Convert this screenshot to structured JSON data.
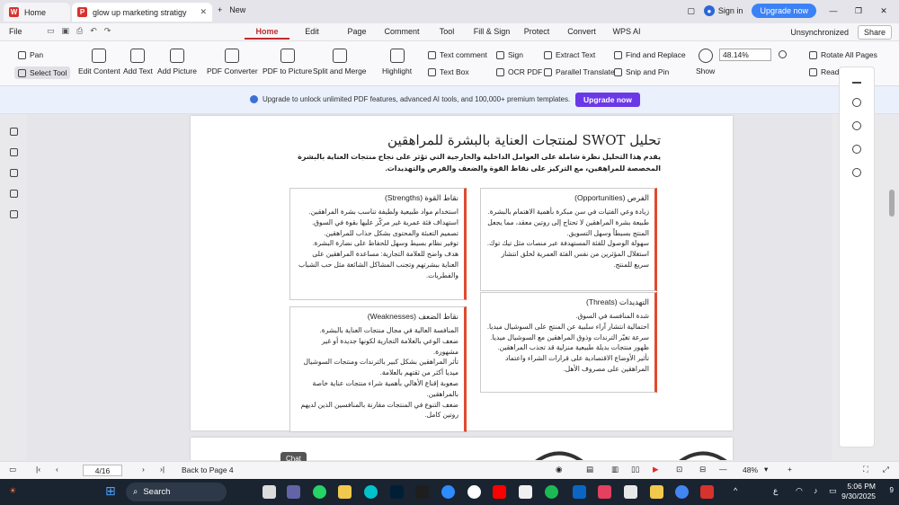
{
  "tabs": {
    "home": "Home",
    "doc": "glow up marketing stratigy",
    "new": "New"
  },
  "account": {
    "signin": "Sign in",
    "upgrade": "Upgrade now"
  },
  "menu": {
    "file": "File",
    "items": [
      "Home",
      "Edit",
      "Page",
      "Comment",
      "Tool",
      "Fill & Sign",
      "Protect",
      "Convert",
      "WPS AI"
    ],
    "sync": "Unsynchronized",
    "share": "Share"
  },
  "ribbon": {
    "pan": "Pan",
    "select": "Select Tool",
    "edit_content": "Edit Content",
    "add_text": "Add Text",
    "add_picture": "Add Picture",
    "pdf_converter": "PDF Converter",
    "pdf_to_picture": "PDF to Picture",
    "split_merge": "Split and Merge",
    "highlight": "Highlight",
    "text_comment": "Text comment",
    "text_box": "Text Box",
    "sign": "Sign",
    "ocr": "OCR PDF",
    "extract": "Extract Text",
    "parallel": "Parallel Translate",
    "find_replace": "Find and Replace",
    "snip_pin": "Snip and Pin",
    "show": "Show",
    "zoom": "48.14%",
    "rotate": "Rotate All Pages",
    "read": "Read M"
  },
  "banner": {
    "text": "Upgrade to unlock unlimited PDF features, advanced AI tools, and 100,000+ premium templates.",
    "button": "Upgrade now"
  },
  "document": {
    "title": "تحليل SWOT لمنتجات العناية بالبشرة للمراهقين",
    "intro": "يقدم هذا التحليل نظرة شاملة على العوامل الداخلية والخارجية التي تؤثر على نجاح منتجات العناية بالبشرة المخصصة للمراهقين، مع التركيز على نقاط القوة والضعف والفرص والتهديدات.",
    "opportunities_title": "الفرص (Opportunities)",
    "opportunities": [
      "زيادة وعي الفتيات في سن مبكرة بأهمية الاهتمام بالبشرة.",
      "طبيعة بشرة المراهقين لا تحتاج إلى روتين معقد، مما يجعل المنتج بسيطاً وسهل التسويق.",
      "سهولة الوصول للفئة المستهدفة عبر منصات مثل تيك توك.",
      "استغلال المؤثرين من نفس الفئة العمرية لخلق انتشار سريع للمنتج."
    ],
    "strengths_title": "نقاط القوة (Strengths)",
    "strengths": [
      "استخدام مواد طبيعية ولطيفة تناسب بشرة المراهقين.",
      "استهداف فئة عمرية غير مركّز عليها بقوة في السوق.",
      "تصميم التعبئة والمحتوى بشكل جذاب للمراهقين.",
      "توفير نظام بسيط وسهل للحفاظ على نضارة البشرة.",
      "هدف واضح للعلامة التجارية: مساعدة المراهقين على العناية ببشرتهم وتجنب المشاكل الشائعة مثل حب الشباب والفطريات."
    ],
    "threats_title": "التهديدات (Threats)",
    "threats": [
      "شدة المنافسة في السوق.",
      "احتمالية انتشار آراء سلبية عن المنتج على السوشيال ميديا.",
      "سرعة تغيّر الترندات وذوق المراهقين مع السوشيال ميديا.",
      "ظهور منتجات بديلة طبيعية منزلية قد تجذب المراهقين.",
      "تأثير الأوضاع الاقتصادية على قرارات الشراء واعتماد المراهقين على مصروف الأهل."
    ],
    "weaknesses_title": "نقاط الضعف (Weaknesses)",
    "weaknesses": [
      "المنافسة العالية في مجال منتجات العناية بالبشرة.",
      "ضعف الوعي بالعلامة التجارية لكونها جديدة أو غير مشهورة.",
      "تأثر المراهقين بشكل كبير بالترندات ومنتجات السوشيال ميديا أكثر من ثقتهم بالعلامة.",
      "صعوبة إقناع الأهالي بأهمية شراء منتجات عناية خاصة بالمراهقين.",
      "ضعف التنوع في المنتجات مقارنة بالمنافسين الذين لديهم روتين كامل."
    ]
  },
  "status": {
    "page": "4/16",
    "back": "Back to Page 4",
    "zoom": "48%",
    "chat": "Chat"
  },
  "taskbar": {
    "search": "Search",
    "time": "5:06 PM",
    "date": "9/30/2025"
  }
}
